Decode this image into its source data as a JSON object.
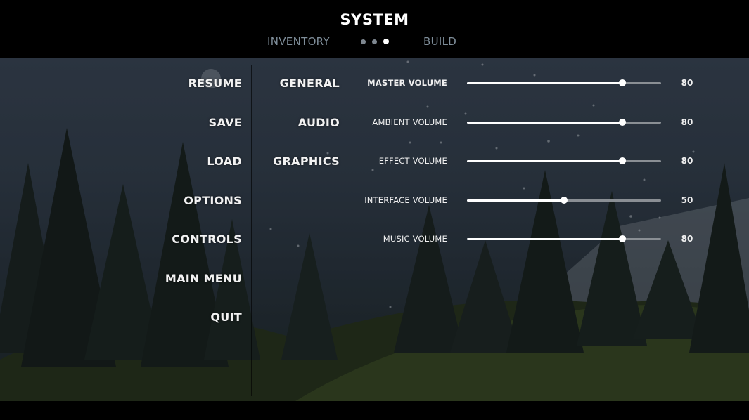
{
  "header": {
    "title": "SYSTEM",
    "tab_left": "INVENTORY",
    "tab_right": "BUILD",
    "page_dots": [
      false,
      false,
      true
    ]
  },
  "main_menu": {
    "items": [
      {
        "label": "RESUME"
      },
      {
        "label": "SAVE"
      },
      {
        "label": "LOAD"
      },
      {
        "label": "OPTIONS"
      },
      {
        "label": "CONTROLS"
      },
      {
        "label": "MAIN MENU"
      },
      {
        "label": "QUIT"
      }
    ]
  },
  "options_menu": {
    "items": [
      {
        "label": "GENERAL"
      },
      {
        "label": "AUDIO"
      },
      {
        "label": "GRAPHICS"
      }
    ]
  },
  "audio_settings": [
    {
      "label": "MASTER VOLUME",
      "value": "80",
      "level": 0.8
    },
    {
      "label": "AMBIENT VOLUME",
      "value": "80",
      "level": 0.8
    },
    {
      "label": "EFFECT VOLUME",
      "value": "80",
      "level": 0.8
    },
    {
      "label": "INTERFACE VOLUME",
      "value": "50",
      "level": 0.5
    },
    {
      "label": "MUSIC VOLUME",
      "value": "80",
      "level": 0.8
    }
  ],
  "colors": {
    "header_bg": "#000000",
    "tab_inactive": "#7f8e9a",
    "text": "#f2f2f2",
    "slider_track": "#8a8f94",
    "slider_fill": "#ffffff"
  }
}
